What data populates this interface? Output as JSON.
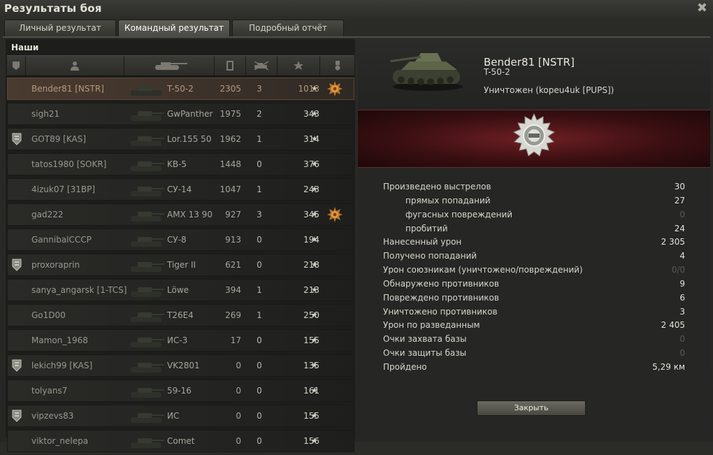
{
  "window": {
    "title": "Результаты боя",
    "close_symbol": "✖"
  },
  "tabs": [
    {
      "label": "Личный результат",
      "active": false
    },
    {
      "label": "Командный результат",
      "active": true
    },
    {
      "label": "Подробный отчёт",
      "active": false
    }
  ],
  "team": {
    "title": "Наши",
    "columns": [
      "rank-icon",
      "player-icon",
      "tank-icon",
      "xp-icon",
      "kills-icon",
      "damage-star-icon",
      "medal-icon"
    ],
    "players": [
      {
        "name": "Bender81 [NSTR]",
        "tank": "T-50-2",
        "xp": "2305",
        "kills": "3",
        "damage": "1013",
        "badge": false,
        "medal": true,
        "me": true
      },
      {
        "name": "sigh21",
        "tank": "GwPanther",
        "xp": "1975",
        "kills": "2",
        "damage": "343",
        "badge": false,
        "medal": false
      },
      {
        "name": "GOT89 [KAS]",
        "tank": "Lor.155 50",
        "xp": "1962",
        "kills": "1",
        "damage": "314",
        "badge": true,
        "medal": false
      },
      {
        "name": "tatos1980 [SOKR]",
        "tank": "KB-5",
        "xp": "1448",
        "kills": "0",
        "damage": "376",
        "badge": false,
        "medal": false
      },
      {
        "name": "4izuk07 [31BP]",
        "tank": "СУ-14",
        "xp": "1047",
        "kills": "1",
        "damage": "243",
        "badge": false,
        "medal": false
      },
      {
        "name": "gad222",
        "tank": "AMX 13 90",
        "xp": "927",
        "kills": "3",
        "damage": "345",
        "badge": false,
        "medal": true
      },
      {
        "name": "GannibalCCCP",
        "tank": "СУ-8",
        "xp": "913",
        "kills": "0",
        "damage": "194",
        "badge": false,
        "medal": false
      },
      {
        "name": "proxoraprin",
        "tank": "Tiger II",
        "xp": "621",
        "kills": "0",
        "damage": "218",
        "badge": true,
        "medal": false
      },
      {
        "name": "sanya_angarsk [1-TCS]",
        "tank": "Löwe",
        "xp": "394",
        "kills": "1",
        "damage": "213",
        "badge": false,
        "medal": false
      },
      {
        "name": "Go1D00",
        "tank": "T26E4",
        "xp": "269",
        "kills": "1",
        "damage": "250",
        "badge": false,
        "medal": false
      },
      {
        "name": "Mamon_1968",
        "tank": "ИС-3",
        "xp": "17",
        "kills": "0",
        "damage": "155",
        "badge": false,
        "medal": false
      },
      {
        "name": "lekich99 [KAS]",
        "tank": "VK2801",
        "xp": "0",
        "kills": "0",
        "damage": "135",
        "badge": true,
        "medal": false
      },
      {
        "name": "tolyans7",
        "tank": "59-16",
        "xp": "0",
        "kills": "0",
        "damage": "161",
        "badge": false,
        "medal": false
      },
      {
        "name": "vipzevs83",
        "tank": "ИС",
        "xp": "0",
        "kills": "0",
        "damage": "155",
        "badge": true,
        "medal": false
      },
      {
        "name": "viktor_nelepa",
        "tank": "Comet",
        "xp": "0",
        "kills": "0",
        "damage": "156",
        "badge": false,
        "medal": false
      }
    ]
  },
  "detail": {
    "player_name": "Bender81 [NSTR]",
    "tank": "T-50-2",
    "status": "Уничтожен (kopeu4uk [PUPS])",
    "stats": [
      {
        "label": "Произведено выстрелов",
        "value": "30",
        "sub": false,
        "dim": false
      },
      {
        "label": "прямых попаданий",
        "value": "27",
        "sub": true,
        "dim": false
      },
      {
        "label": "фугасных повреждений",
        "value": "0",
        "sub": true,
        "dim": true
      },
      {
        "label": "пробитий",
        "value": "24",
        "sub": true,
        "dim": false
      },
      {
        "label": "Нанесенный урон",
        "value": "2 305",
        "sub": false,
        "dim": false
      },
      {
        "label": "Получено попаданий",
        "value": "4",
        "sub": false,
        "dim": false
      },
      {
        "label": "Урон союзникам (уничтожено/повреждений)",
        "value": "0/0",
        "sub": false,
        "dim": true
      },
      {
        "label": "Обнаружено противников",
        "value": "9",
        "sub": false,
        "dim": false
      },
      {
        "label": "Повреждено противников",
        "value": "6",
        "sub": false,
        "dim": false
      },
      {
        "label": "Уничтожено противников",
        "value": "3",
        "sub": false,
        "dim": false
      },
      {
        "label": "Урон по разведанным",
        "value": "2 405",
        "sub": false,
        "dim": false
      },
      {
        "label": "Очки захвата базы",
        "value": "0",
        "sub": false,
        "dim": true
      },
      {
        "label": "Очки защиты базы",
        "value": "0",
        "sub": false,
        "dim": true
      },
      {
        "label": "Пройдено",
        "value": "5,29 км",
        "sub": false,
        "dim": false
      }
    ],
    "close_button": "Закрыть"
  }
}
